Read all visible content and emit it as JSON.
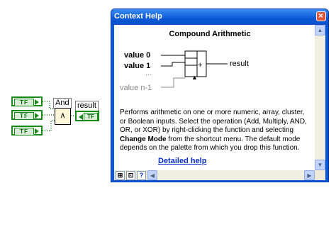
{
  "diagram": {
    "controls": [
      {
        "label": "TF"
      },
      {
        "label": "TF"
      },
      {
        "label": "TF"
      }
    ],
    "and_node": {
      "label": "And",
      "symbol": "∧"
    },
    "indicator": {
      "label": "result",
      "text": "TF"
    }
  },
  "context_help": {
    "window_title": "Context Help",
    "close_glyph": "×",
    "function_name": "Compound Arithmetic",
    "inputs": [
      "value 0",
      "value 1",
      "...",
      "value n-1"
    ],
    "output": "result",
    "node_symbol": "+",
    "description_before": "Performs arithmetic on one or more numeric, array, cluster, or Boolean inputs. Select the operation (Add, Multiply, AND, OR, or XOR) by right-clicking the function and selecting ",
    "description_bold": "Change Mode",
    "description_after": " from the shortcut menu. The default mode depends on the palette from which you drop this function.",
    "link": "Detailed help",
    "toolbar": {
      "help_button": "?"
    }
  },
  "colors": {
    "wire": "#178a17",
    "titlebar": "#0a58d8",
    "link": "#0a2dcc"
  }
}
